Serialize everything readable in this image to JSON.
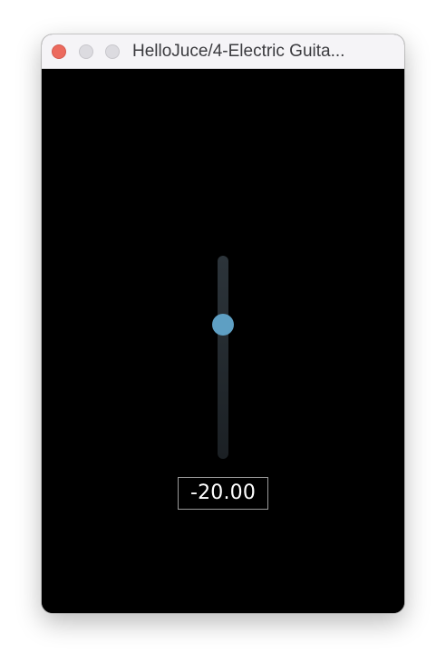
{
  "window": {
    "title": "HelloJuce/4-Electric Guita..."
  },
  "controls": {
    "close": "close-icon",
    "minimize": "minimize-icon",
    "zoom": "zoom-icon"
  },
  "slider": {
    "value": -20.0,
    "value_label": "-20.00",
    "level_fraction": 0.66,
    "track_color": "#2c343a",
    "thumb_color": "#5e9fc3"
  },
  "colors": {
    "background": "#000000",
    "titlebar": "#f5f4f7",
    "close": "#ec6a5e",
    "inactive_button": "#dcdbe0"
  }
}
